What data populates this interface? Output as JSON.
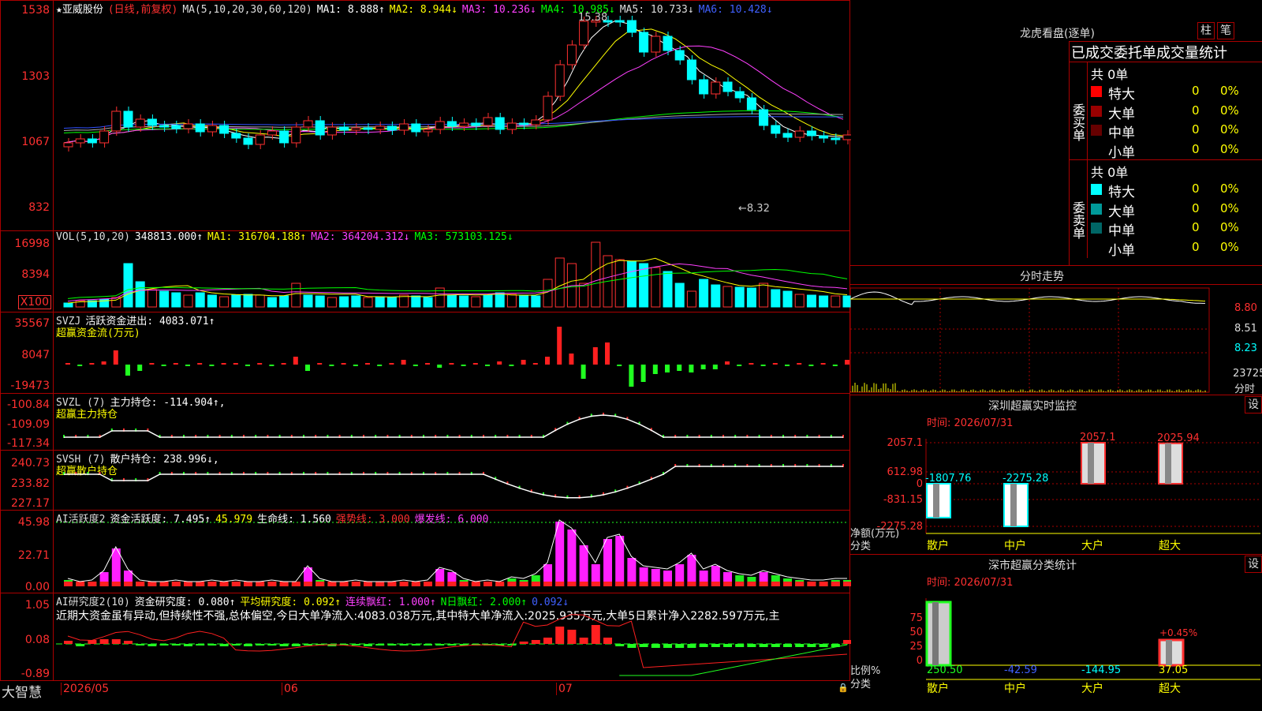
{
  "main": {
    "stock_name": "亚威股份",
    "period_tag": "(日线,前复权)",
    "ma_label": "MA(5,10,20,30,60,120)",
    "ma_values": [
      "MA1: 8.888↑",
      "MA2: 8.944↓",
      "MA3: 10.236↓",
      "MA4: 10.985↓",
      "MA5: 10.733↓",
      "MA6: 10.428↓"
    ],
    "ticks": [
      "1538",
      "1303",
      "1067",
      "832"
    ],
    "high_label": "15.38",
    "low_label": "←8.32"
  },
  "vol": {
    "label": "VOL(5,10,20)",
    "value": "348813.000↑",
    "ma": [
      "MA1: 316704.188↑",
      "MA2: 364204.312↓",
      "MA3: 573103.125↓"
    ],
    "ticks": [
      "16998",
      "8394"
    ],
    "unit": "X100"
  },
  "svzj": {
    "label": "SVZJ",
    "name": "活跃资金进出: 4083.071↑",
    "sub": "超赢资金流(万元)",
    "ticks": [
      "35567",
      "8047",
      "-19473"
    ]
  },
  "svzl": {
    "label": "SVZL (7)",
    "name": "主力持仓: -114.904↑,",
    "sub": "超赢主力持仓",
    "ticks": [
      "-100.84",
      "-109.09",
      "-117.34"
    ]
  },
  "svsh": {
    "label": "SVSH (7)",
    "name": "散户持仓: 238.996↓,",
    "sub": "超赢散户持仓",
    "ticks": [
      "240.73",
      "233.82",
      "227.17"
    ]
  },
  "ai1": {
    "label": "AI活跃度2",
    "items": [
      "资金活跃度: 7.495↑",
      "45.979",
      "生命线: 1.560",
      "强势线: 3.000",
      "爆发线: 6.000"
    ],
    "ticks": [
      "45.98",
      "22.71",
      "0.00"
    ]
  },
  "ai2": {
    "label": "AI研究度2(10)",
    "items": [
      "资金研究度: 0.080↑",
      "平均研究度: 0.092↑",
      "连续飘红: 1.000↑",
      "N日飘红: 2.000↑",
      "0.092↓"
    ],
    "summary": "近期大资金虽有异动,但持续性不强,总体偏空,今日大单净流入:4083.038万元,其中特大单净流入:2025.935万元,大单5日累计净入2282.597万元,主",
    "ticks": [
      "1.05",
      "0.08",
      "-0.89"
    ]
  },
  "xaxis": {
    "labels": [
      "2026/05",
      "06",
      "07"
    ],
    "brand": "大智慧"
  },
  "right": {
    "lhb_title": "龙虎看盘(逐单)",
    "btn_bar": "柱",
    "btn_pen": "笔",
    "tabs_title": "已成交委托单成交量统计",
    "buy_total": "共 0单",
    "sell_total": "共 0单",
    "buy_label": "委买单",
    "sell_label": "委卖单",
    "rows": [
      {
        "name": "特大",
        "val": "0",
        "pct": "0%"
      },
      {
        "name": "大单",
        "val": "0",
        "pct": "0%"
      },
      {
        "name": "中单",
        "val": "0",
        "pct": "0%"
      },
      {
        "name": "小单",
        "val": "0",
        "pct": "0%"
      }
    ],
    "srows": [
      {
        "name": "特大",
        "val": "0",
        "pct": "0%"
      },
      {
        "name": "大单",
        "val": "0",
        "pct": "0%"
      },
      {
        "name": "中单",
        "val": "0",
        "pct": "0%"
      },
      {
        "name": "小单",
        "val": "0",
        "pct": "0%"
      }
    ],
    "minute_title": "分时走势",
    "minute_ticks": [
      "8.80",
      "8.51",
      "8.23"
    ],
    "minute_vol": "23725",
    "minute_vol_label": "分时",
    "monitor_title": "深圳超赢实时监控",
    "monitor_btn": "设",
    "monitor_time": "时间: 2026/07/31",
    "monitor_ticks": [
      "2057.1",
      "612.98",
      "0",
      "-831.15",
      "-2275.28"
    ],
    "monitor_bars": [
      {
        "name": "散户",
        "value": "-1807.76"
      },
      {
        "name": "中户",
        "value": "-2275.28"
      },
      {
        "name": "大户",
        "value": "2057.1"
      },
      {
        "name": "超大",
        "value": "2025.94"
      }
    ],
    "monitor_ylabel": "净额(万元)",
    "monitor_xlabel": "分类",
    "class_title": "深市超赢分类统计",
    "class_btn": "设",
    "class_time": "时间: 2026/07/31",
    "class_ticks": [
      "75",
      "50",
      "25",
      "0"
    ],
    "class_bars": [
      {
        "name": "散户",
        "value": "250.50"
      },
      {
        "name": "中户",
        "value": "-42.59"
      },
      {
        "name": "大户",
        "value": "-144.95"
      },
      {
        "name": "超大",
        "value": "37.05"
      }
    ],
    "class_pct": "+0.45%",
    "class_ylabel": "比例%",
    "class_xlabel": "分类"
  },
  "colors": {
    "up": "#ff3030",
    "down": "#00ffff",
    "frame": "#aa0000"
  }
}
